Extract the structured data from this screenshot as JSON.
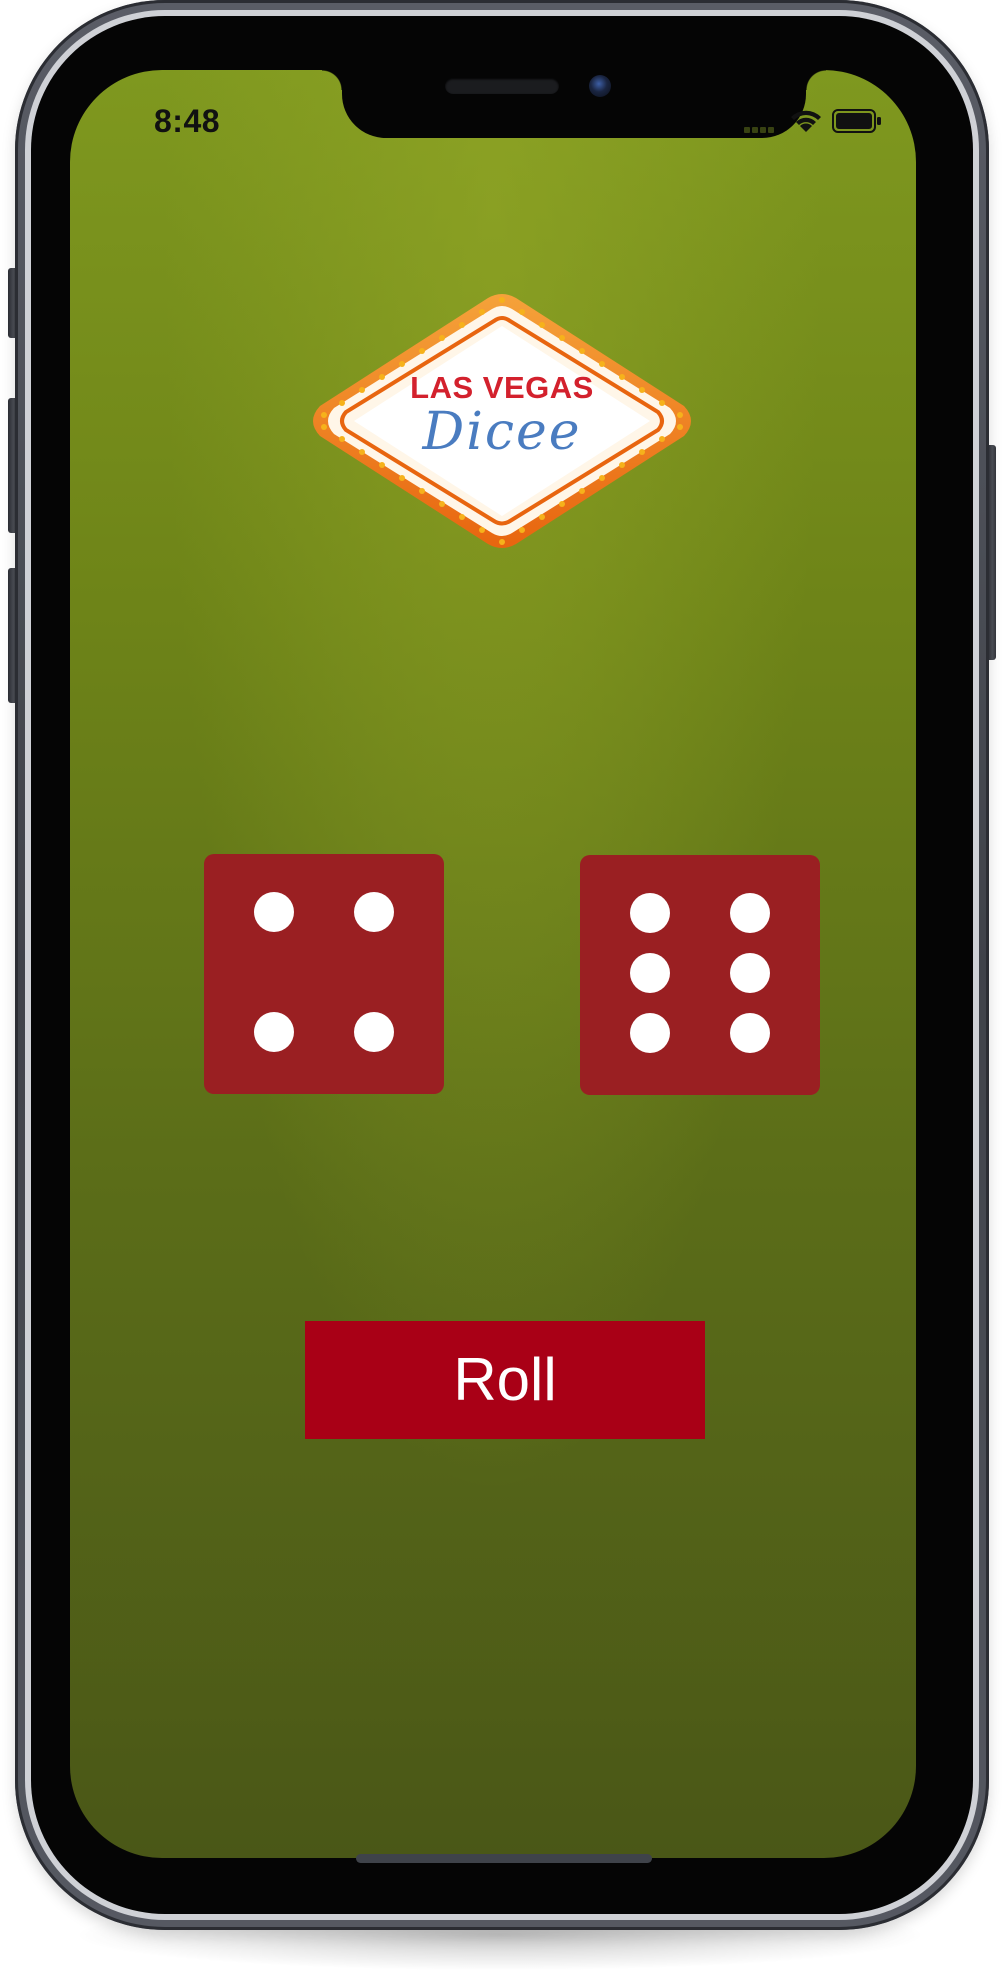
{
  "status_bar": {
    "time": "8:48"
  },
  "logo": {
    "line1": "LAS VEGAS",
    "line2": "Dicee"
  },
  "dice": [
    {
      "name": "left-die",
      "value": 4
    },
    {
      "name": "right-die",
      "value": 6
    }
  ],
  "roll_button": {
    "label": "Roll"
  },
  "colors": {
    "felt": "#6e8418",
    "die": "#9a1f22",
    "button": "#a90016",
    "logo_red": "#d3212d",
    "logo_blue": "#4a7cc0",
    "logo_orange": "#e8650f"
  }
}
